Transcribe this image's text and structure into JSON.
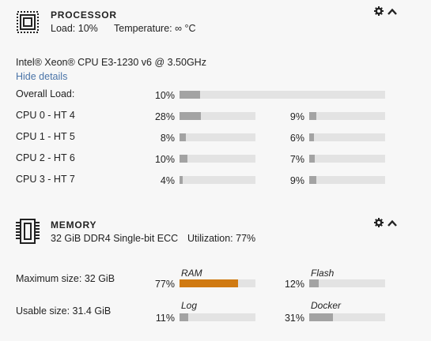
{
  "processor": {
    "title": "PROCESSOR",
    "load_text": "Load: 10%",
    "temperature_text": "Temperature: ∞ °C",
    "model": "Intel® Xeon® CPU E3-1230 v6 @ 3.50GHz",
    "toggle_details": "Hide details",
    "overall_label": "Overall Load:",
    "overall_pct": "10%",
    "overall_value": 10,
    "cores": [
      {
        "label": "CPU 0 - HT 4",
        "a_pct": "28%",
        "a_value": 28,
        "b_pct": "9%",
        "b_value": 9
      },
      {
        "label": "CPU 1 - HT 5",
        "a_pct": "8%",
        "a_value": 8,
        "b_pct": "6%",
        "b_value": 6
      },
      {
        "label": "CPU 2 - HT 6",
        "a_pct": "10%",
        "a_value": 10,
        "b_pct": "7%",
        "b_value": 7
      },
      {
        "label": "CPU 3 - HT 7",
        "a_pct": "4%",
        "a_value": 4,
        "b_pct": "9%",
        "b_value": 9
      }
    ]
  },
  "memory": {
    "title": "MEMORY",
    "summary": "32 GiB DDR4 Single-bit ECC",
    "utilization_text": "Utilization: 77%",
    "max_size": "Maximum size: 32 GiB",
    "usable_size": "Usable size: 31.4 GiB",
    "bars": [
      {
        "name": "RAM",
        "pct": "77%",
        "value": 77,
        "color": "#d07a12"
      },
      {
        "name": "Flash",
        "pct": "12%",
        "value": 12,
        "color": "#a3a3a3"
      },
      {
        "name": "Log",
        "pct": "11%",
        "value": 11,
        "color": "#a3a3a3"
      },
      {
        "name": "Docker",
        "pct": "31%",
        "value": 31,
        "color": "#a3a3a3"
      }
    ]
  },
  "icons": {
    "cpu": "cpu-chip-icon",
    "memory": "memory-module-icon",
    "settings": "gear-icon",
    "collapse": "chevron-up-icon"
  }
}
